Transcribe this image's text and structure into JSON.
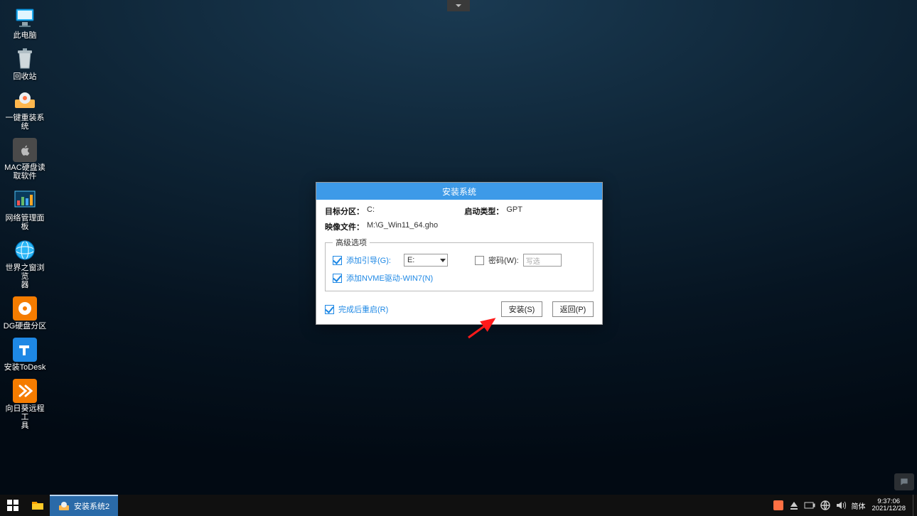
{
  "desktop_icons": {
    "this_pc": "此电脑",
    "recycle_bin": "回收站",
    "one_key_install": "一键重装系统",
    "mac_disk_reader": "MAC硬盘读\n取软件",
    "network_panel": "网络管理面板",
    "world_browser": "世界之窗浏览\n器",
    "dg_partition": "DG硬盘分区",
    "install_todesk": "安装ToDesk",
    "sunflower_tool": "向日葵远程工\n具"
  },
  "dialog": {
    "title": "安装系统",
    "target_label": "目标分区：",
    "target_value": "C:",
    "boot_type_label": "启动类型：",
    "boot_type_value": "GPT",
    "image_label": "映像文件：",
    "image_value": "M:\\G_Win11_64.gho",
    "adv_legend": "高级选项",
    "add_boot_label": "添加引导(G):",
    "add_boot_select": "E:",
    "password_label": "密码(W):",
    "password_placeholder": "写选",
    "add_nvme_label": "添加NVME驱动-WIN7(N)",
    "reboot_after_label": "完成后重启(R)",
    "install_btn": "安装(S)",
    "back_btn": "返回(P)"
  },
  "taskbar": {
    "active_task": "安装系统2",
    "ime": "简体",
    "time": "9:37:06",
    "date": "2021/12/28"
  }
}
